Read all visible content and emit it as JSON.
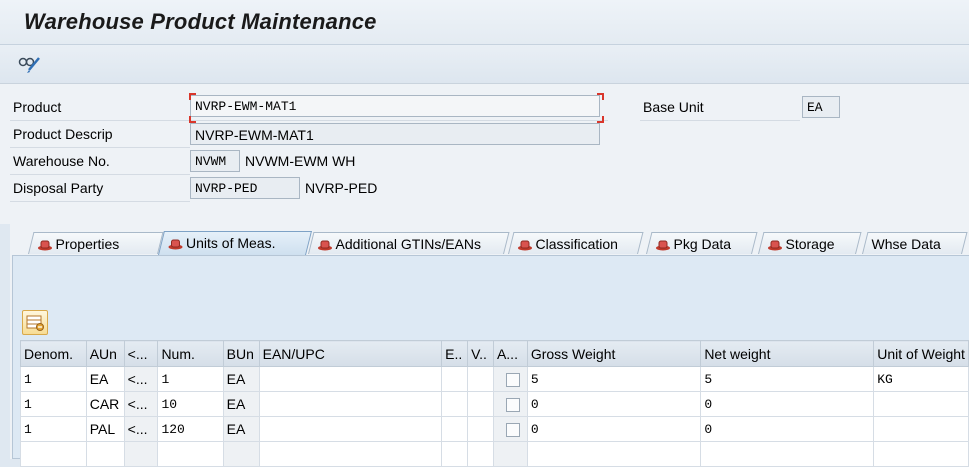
{
  "window": {
    "title": "Warehouse Product Maintenance"
  },
  "toolbar": {
    "display_change_icon": "glasses-pencil-icon"
  },
  "header": {
    "product_label": "Product",
    "product_value": "NVRP-EWM-MAT1",
    "base_unit_label": "Base Unit",
    "base_unit_value": "EA",
    "descrip_label": "Product Descrip",
    "descrip_value": "NVRP-EWM-MAT1",
    "warehouse_label": "Warehouse No.",
    "warehouse_value": "NVWM",
    "warehouse_text": "NVWM-EWM WH",
    "disposal_label": "Disposal Party",
    "disposal_value": "NVRP-PED",
    "disposal_text": "NVRP-PED"
  },
  "tabs": [
    {
      "label": "Properties",
      "icon": "hat-icon",
      "selected": false
    },
    {
      "label": "Units of Meas.",
      "icon": "hat-icon",
      "selected": true
    },
    {
      "label": "Additional GTINs/EANs",
      "icon": "hat-icon",
      "selected": false
    },
    {
      "label": "Classification",
      "icon": "hat-icon",
      "selected": false
    },
    {
      "label": "Pkg Data",
      "icon": "hat-icon",
      "selected": false
    },
    {
      "label": "Storage",
      "icon": "hat-icon",
      "selected": false
    },
    {
      "label": "Whse Data",
      "icon": "",
      "selected": false
    }
  ],
  "table": {
    "settings_icon": "table-settings-icon",
    "columns": [
      "Denom.",
      "AUn",
      "<...",
      "Num.",
      "BUn",
      "EAN/UPC",
      "E..",
      "V..",
      "A...",
      "Gross Weight",
      "Net weight",
      "Unit of Weight"
    ],
    "rows": [
      {
        "denom": "1",
        "aun": "EA",
        "lt": "<...",
        "num": "1",
        "bun": "EA",
        "ean": "",
        "e": "",
        "v": "",
        "a": false,
        "gross": "5",
        "net": "5",
        "unit": "KG"
      },
      {
        "denom": "1",
        "aun": "CAR",
        "lt": "<...",
        "num": "10",
        "bun": "EA",
        "ean": "",
        "e": "",
        "v": "",
        "a": false,
        "gross": "0",
        "net": "0",
        "unit": ""
      },
      {
        "denom": "1",
        "aun": "PAL",
        "lt": "<...",
        "num": "120",
        "bun": "EA",
        "ean": "",
        "e": "",
        "v": "",
        "a": false,
        "gross": "0",
        "net": "0",
        "unit": ""
      }
    ]
  }
}
